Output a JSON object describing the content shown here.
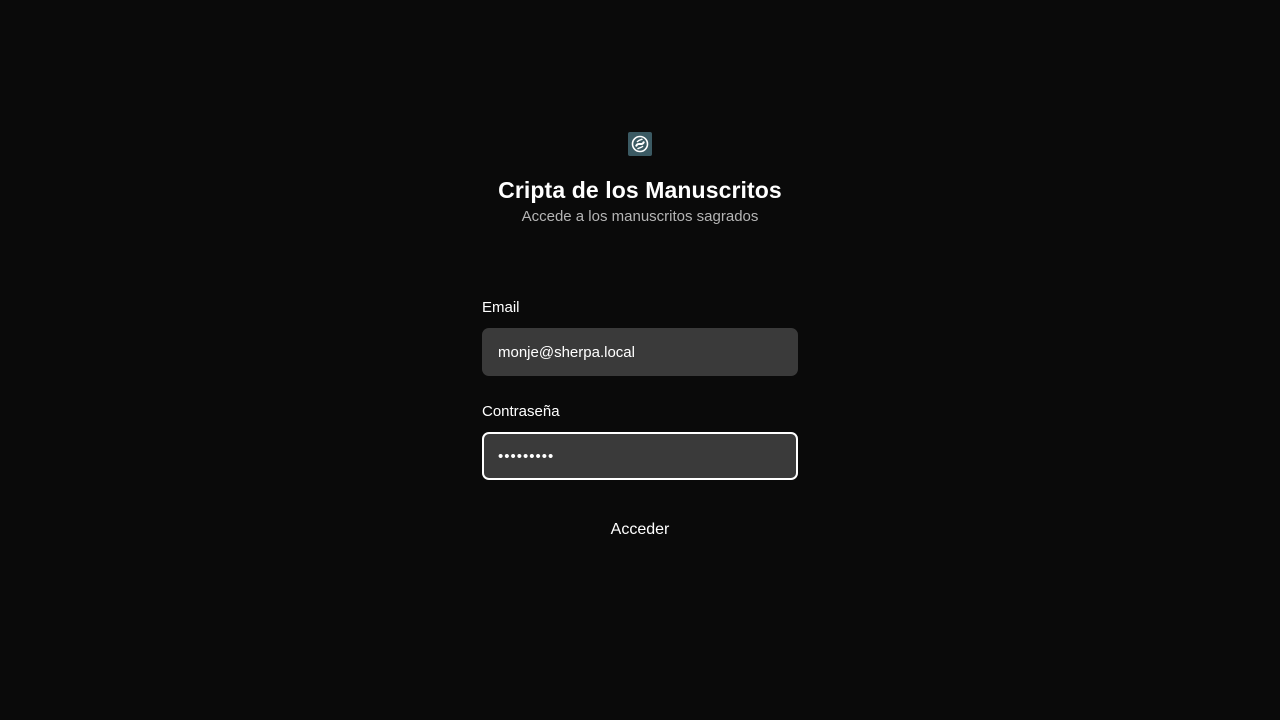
{
  "app": {
    "logo_icon": "swirl-logo-icon",
    "logo_color": "#3b5a63",
    "title": "Cripta de los Manuscritos",
    "subtitle": "Accede a los manuscritos sagrados"
  },
  "form": {
    "email": {
      "label": "Email",
      "value": "monje@sherpa.local"
    },
    "password": {
      "label": "Contraseña",
      "value": "•••••••••"
    },
    "submit_label": "Acceder"
  },
  "colors": {
    "background": "#0a0a0a",
    "field_background": "#3a3a3a",
    "focus_border": "#ffffff",
    "subtitle_text": "#b5b5b5"
  }
}
